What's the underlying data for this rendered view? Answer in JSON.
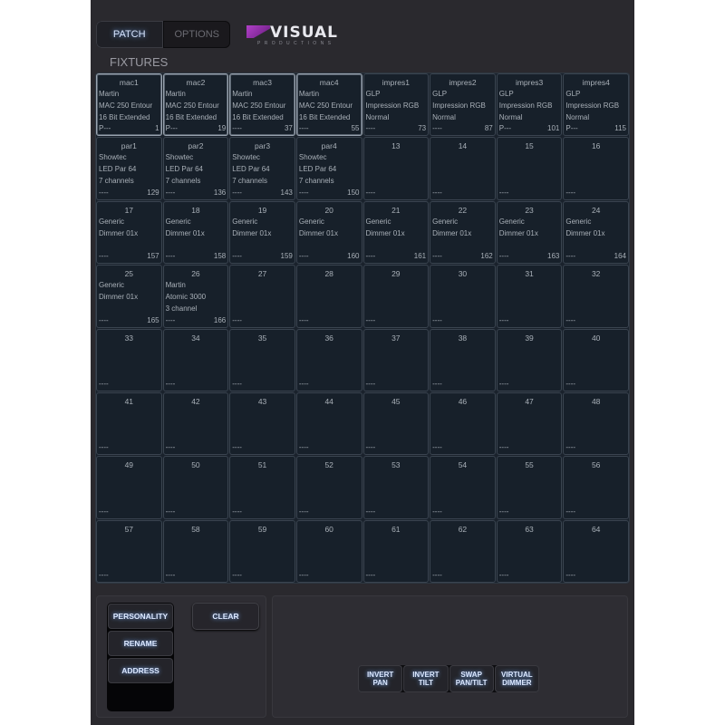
{
  "tabs": [
    {
      "label": "PATCH",
      "active": true
    },
    {
      "label": "OPTIONS",
      "active": false
    }
  ],
  "logo": {
    "word": "VISUAL",
    "sub": "PRODUCTIONS"
  },
  "section_title": "FIXTURES",
  "cells": [
    {
      "title": "mac1",
      "l1": "Martin",
      "l2": "MAC 250 Entour",
      "l3": "16 Bit Extended",
      "foot": "P---",
      "addr": "1",
      "selected": true
    },
    {
      "title": "mac2",
      "l1": "Martin",
      "l2": "MAC 250 Entour",
      "l3": "16 Bit Extended",
      "foot": "P---",
      "addr": "19",
      "selected": true
    },
    {
      "title": "mac3",
      "l1": "Martin",
      "l2": "MAC 250 Entour",
      "l3": "16 Bit Extended",
      "foot": "----",
      "addr": "37",
      "selected": true
    },
    {
      "title": "mac4",
      "l1": "Martin",
      "l2": "MAC 250 Entour",
      "l3": "16 Bit Extended",
      "foot": "----",
      "addr": "55",
      "selected": true
    },
    {
      "title": "impres1",
      "l1": "GLP",
      "l2": "Impression RGB",
      "l3": "Normal",
      "foot": "----",
      "addr": "73"
    },
    {
      "title": "impres2",
      "l1": "GLP",
      "l2": "Impression RGB",
      "l3": "Normal",
      "foot": "----",
      "addr": "87"
    },
    {
      "title": "impres3",
      "l1": "GLP",
      "l2": "Impression RGB",
      "l3": "Normal",
      "foot": "P---",
      "addr": "101"
    },
    {
      "title": "impres4",
      "l1": "GLP",
      "l2": "Impression RGB",
      "l3": "Normal",
      "foot": "P---",
      "addr": "115"
    },
    {
      "title": "par1",
      "l1": "Showtec",
      "l2": "LED Par 64",
      "l3": "7 channels",
      "foot": "----",
      "addr": "129"
    },
    {
      "title": "par2",
      "l1": "Showtec",
      "l2": "LED Par 64",
      "l3": "7 channels",
      "foot": "----",
      "addr": "136"
    },
    {
      "title": "par3",
      "l1": "Showtec",
      "l2": "LED Par 64",
      "l3": "7 channels",
      "foot": "----",
      "addr": "143"
    },
    {
      "title": "par4",
      "l1": "Showtec",
      "l2": "LED Par 64",
      "l3": "7 channels",
      "foot": "----",
      "addr": "150"
    },
    {
      "title": "13",
      "foot": "----"
    },
    {
      "title": "14",
      "foot": "----"
    },
    {
      "title": "15",
      "foot": "----"
    },
    {
      "title": "16",
      "foot": "----"
    },
    {
      "title": "17",
      "l1": "Generic",
      "l2": "Dimmer 01x",
      "foot": "----",
      "addr": "157"
    },
    {
      "title": "18",
      "l1": "Generic",
      "l2": "Dimmer 01x",
      "foot": "----",
      "addr": "158"
    },
    {
      "title": "19",
      "l1": "Generic",
      "l2": "Dimmer 01x",
      "foot": "----",
      "addr": "159"
    },
    {
      "title": "20",
      "l1": "Generic",
      "l2": "Dimmer 01x",
      "foot": "----",
      "addr": "160"
    },
    {
      "title": "21",
      "l1": "Generic",
      "l2": "Dimmer 01x",
      "foot": "----",
      "addr": "161"
    },
    {
      "title": "22",
      "l1": "Generic",
      "l2": "Dimmer 01x",
      "foot": "----",
      "addr": "162"
    },
    {
      "title": "23",
      "l1": "Generic",
      "l2": "Dimmer 01x",
      "foot": "----",
      "addr": "163"
    },
    {
      "title": "24",
      "l1": "Generic",
      "l2": "Dimmer 01x",
      "foot": "----",
      "addr": "164"
    },
    {
      "title": "25",
      "l1": "Generic",
      "l2": "Dimmer 01x",
      "foot": "----",
      "addr": "165"
    },
    {
      "title": "26",
      "l1": "Martin",
      "l2": "Atomic 3000",
      "l3": "3 channel",
      "foot": "----",
      "addr": "166"
    },
    {
      "title": "27",
      "foot": "----"
    },
    {
      "title": "28",
      "foot": "----"
    },
    {
      "title": "29",
      "foot": "----"
    },
    {
      "title": "30",
      "foot": "----"
    },
    {
      "title": "31",
      "foot": "----"
    },
    {
      "title": "32",
      "foot": "----"
    },
    {
      "title": "33",
      "foot": "----"
    },
    {
      "title": "34",
      "foot": "----"
    },
    {
      "title": "35",
      "foot": "----"
    },
    {
      "title": "36",
      "foot": "----"
    },
    {
      "title": "37",
      "foot": "----"
    },
    {
      "title": "38",
      "foot": "----"
    },
    {
      "title": "39",
      "foot": "----"
    },
    {
      "title": "40",
      "foot": "----"
    },
    {
      "title": "41",
      "foot": "----"
    },
    {
      "title": "42",
      "foot": "----"
    },
    {
      "title": "43",
      "foot": "----"
    },
    {
      "title": "44",
      "foot": "----"
    },
    {
      "title": "45",
      "foot": "----"
    },
    {
      "title": "46",
      "foot": "----"
    },
    {
      "title": "47",
      "foot": "----"
    },
    {
      "title": "48",
      "foot": "----"
    },
    {
      "title": "49",
      "foot": "----"
    },
    {
      "title": "50",
      "foot": "----"
    },
    {
      "title": "51",
      "foot": "----"
    },
    {
      "title": "52",
      "foot": "----"
    },
    {
      "title": "53",
      "foot": "----"
    },
    {
      "title": "54",
      "foot": "----"
    },
    {
      "title": "55",
      "foot": "----"
    },
    {
      "title": "56",
      "foot": "----"
    },
    {
      "title": "57",
      "foot": "----"
    },
    {
      "title": "58",
      "foot": "----"
    },
    {
      "title": "59",
      "foot": "----"
    },
    {
      "title": "60",
      "foot": "----"
    },
    {
      "title": "61",
      "foot": "----"
    },
    {
      "title": "62",
      "foot": "----"
    },
    {
      "title": "63",
      "foot": "----"
    },
    {
      "title": "64",
      "foot": "----"
    }
  ],
  "mode_buttons": [
    "PERSONALITY",
    "RENAME",
    "ADDRESS"
  ],
  "clear_label": "CLEAR",
  "options": [
    {
      "line1": "INVERT",
      "line2": "PAN"
    },
    {
      "line1": "INVERT",
      "line2": "TILT"
    },
    {
      "line1": "SWAP",
      "line2": "PAN/TILT"
    },
    {
      "line1": "VIRTUAL",
      "line2": "DIMMER"
    }
  ]
}
